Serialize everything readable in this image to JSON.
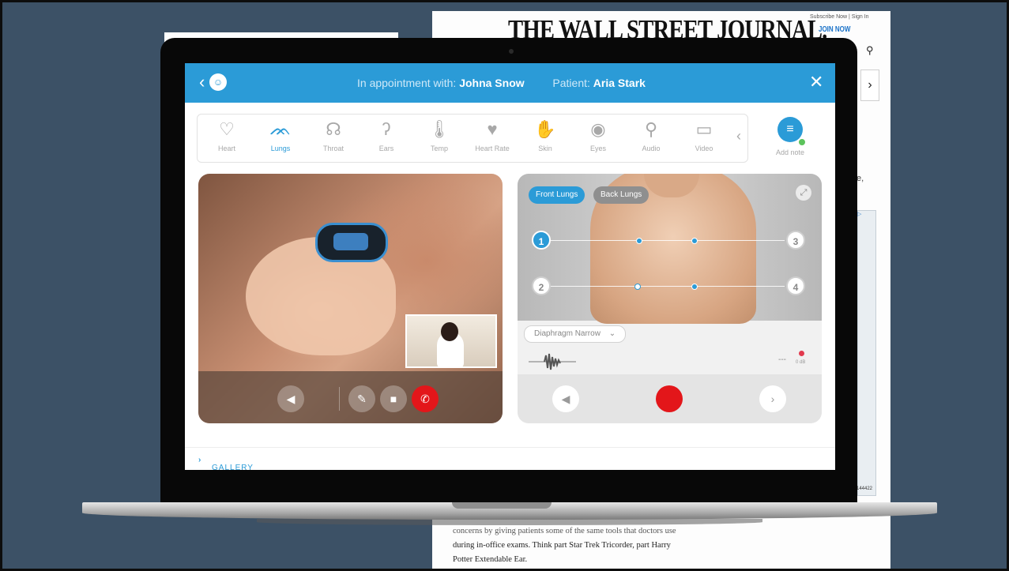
{
  "newspaper": {
    "title": "THE WALL STREET JOURNAL.",
    "subscribe": "Subscribe Now | Sign In",
    "join": "JOIN NOW",
    "search_glyph": "⚲",
    "next_glyph": "›",
    "side_letter": "e,",
    "ad_tag": "▷",
    "side_number": "144422",
    "article_lines": [
      "concerns by giving patients some of the same tools that doctors use",
      "during in-office exams. Think part Star Trek Tricorder, part Harry",
      "Potter Extendable Ear."
    ]
  },
  "header": {
    "back_glyph": "‹",
    "logo_glyph": "☺",
    "appointment_label": "In appointment with:",
    "doctor_name": "Johna Snow",
    "patient_label": "Patient:",
    "patient_name": "Aria Stark",
    "close_glyph": "✕"
  },
  "toolbar": {
    "items": [
      {
        "label": "Heart",
        "icon": "♡"
      },
      {
        "label": "Lungs",
        "icon": "ᨏ"
      },
      {
        "label": "Throat",
        "icon": "☊"
      },
      {
        "label": "Ears",
        "icon": "ʔ"
      },
      {
        "label": "Temp",
        "icon": "🌡"
      },
      {
        "label": "Heart Rate",
        "icon": "♥"
      },
      {
        "label": "Skin",
        "icon": "✋"
      },
      {
        "label": "Eyes",
        "icon": "◉"
      },
      {
        "label": "Audio",
        "icon": "⚲"
      },
      {
        "label": "Video",
        "icon": "▭"
      }
    ],
    "active": "Lungs",
    "more_glyph": "‹",
    "add_note_label": "Add note",
    "add_note_glyph": "≡"
  },
  "video_call": {
    "mute_glyph": "◀",
    "mic_glyph": "✎",
    "camera_glyph": "■",
    "end_call_glyph": "✆",
    "end_call_color": "#e3161a"
  },
  "lungs_panel": {
    "tabs": [
      "Front Lungs",
      "Back Lungs"
    ],
    "active_tab": "Front Lungs",
    "expand_glyph": "⤢",
    "points": [
      "1",
      "2",
      "3",
      "4"
    ],
    "active_point": "1",
    "filter_value": "Diaphragm Narrow",
    "filter_chevron": "⌄",
    "level_dash": "---",
    "mic_label": "0 dB",
    "speaker_glyph": "◀",
    "next_glyph": "›",
    "record_color": "#e3161a"
  },
  "footer": {
    "gallery_label": "GALLERY",
    "gallery_chevron": "›"
  },
  "colors": {
    "accent": "#2b9bd7",
    "background": "#3c5166",
    "danger": "#e3161a"
  }
}
